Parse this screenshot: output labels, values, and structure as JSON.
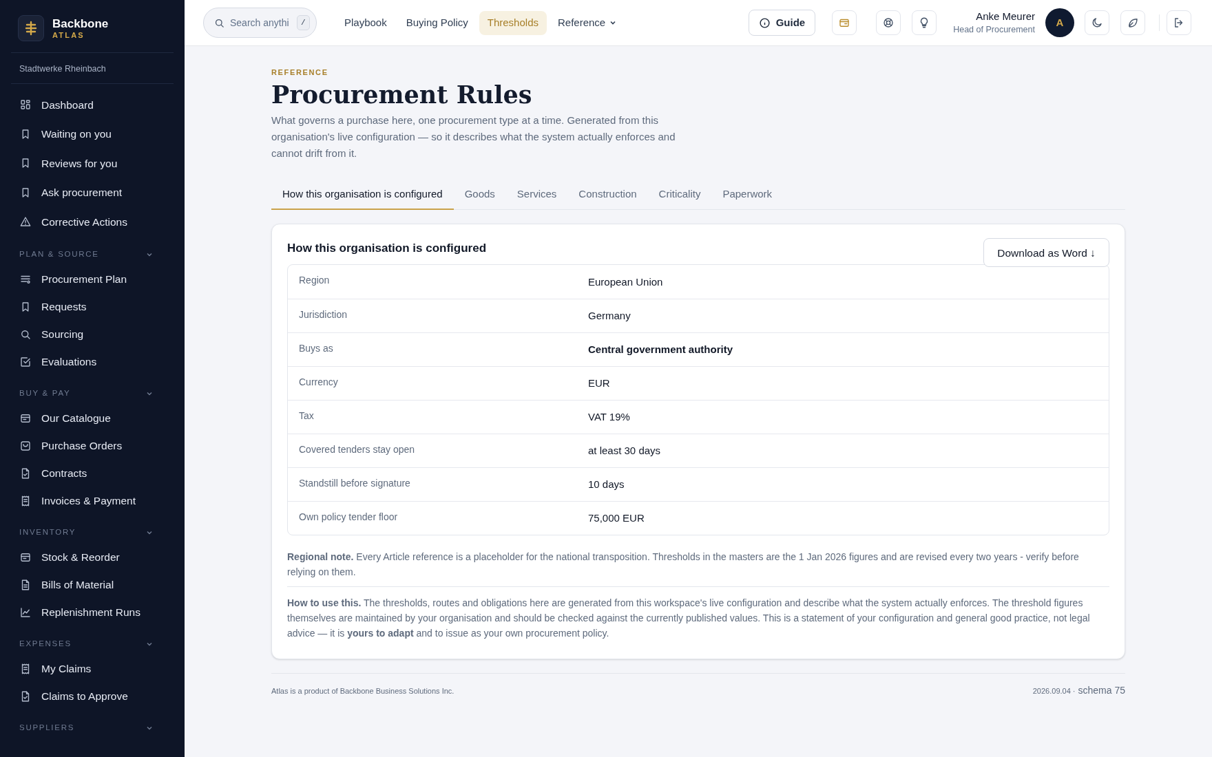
{
  "brand": {
    "name": "Backbone",
    "sub": "ATLAS"
  },
  "organisation": "Stadtwerke Rheinbach",
  "sidebar": {
    "items": [
      {
        "label": "Dashboard"
      },
      {
        "label": "Waiting on you"
      },
      {
        "label": "Reviews for you"
      },
      {
        "label": "Ask procurement"
      },
      {
        "label": "Corrective Actions"
      }
    ],
    "sections": [
      {
        "title": "PLAN & SOURCE",
        "expanded": true,
        "items": [
          {
            "label": "Procurement Plan"
          },
          {
            "label": "Requests"
          },
          {
            "label": "Sourcing"
          },
          {
            "label": "Evaluations"
          }
        ]
      },
      {
        "title": "BUY & PAY",
        "expanded": true,
        "items": [
          {
            "label": "Our Catalogue"
          },
          {
            "label": "Purchase Orders"
          },
          {
            "label": "Contracts"
          },
          {
            "label": "Invoices & Payment"
          }
        ]
      },
      {
        "title": "INVENTORY",
        "expanded": true,
        "items": [
          {
            "label": "Stock & Reorder"
          },
          {
            "label": "Bills of Material"
          },
          {
            "label": "Replenishment Runs"
          }
        ]
      },
      {
        "title": "EXPENSES",
        "expanded": true,
        "items": [
          {
            "label": "My Claims"
          },
          {
            "label": "Claims to Approve"
          }
        ]
      },
      {
        "title": "SUPPLIERS",
        "expanded": true
      }
    ]
  },
  "search": {
    "placeholder": "Search anythi",
    "shortcut": "/"
  },
  "nav": [
    {
      "label": "Playbook",
      "selected": false
    },
    {
      "label": "Buying Policy",
      "selected": false
    },
    {
      "label": "Thresholds",
      "selected": true
    },
    {
      "label": "Reference",
      "selected": false,
      "dropdown": true
    }
  ],
  "guide_button": "Guide",
  "user": {
    "name": "Anke Meurer",
    "role": "Head of Procurement",
    "initial": "A"
  },
  "page": {
    "eyebrow": "REFERENCE",
    "title": "Procurement Rules",
    "intro": "What governs a purchase here, one procurement type at a time. Generated from this organisation's live configuration — so it describes what the system actually enforces and cannot drift from it."
  },
  "tabs": [
    {
      "label": "How this organisation is configured",
      "selected": true
    },
    {
      "label": "Goods",
      "selected": false
    },
    {
      "label": "Services",
      "selected": false
    },
    {
      "label": "Construction",
      "selected": false
    },
    {
      "label": "Criticality",
      "selected": false
    },
    {
      "label": "Paperwork",
      "selected": false
    }
  ],
  "card": {
    "title": "How this organisation is configured",
    "download_button": "Download as Word ↓",
    "rows": [
      {
        "label": "Region",
        "value": "European Union",
        "bold": false
      },
      {
        "label": "Jurisdiction",
        "value": "Germany",
        "bold": false
      },
      {
        "label": "Buys as",
        "value": "Central government authority",
        "bold": true
      },
      {
        "label": "Currency",
        "value": "EUR",
        "bold": false
      },
      {
        "label": "Tax",
        "value": "VAT 19%",
        "bold": false
      },
      {
        "label": "Covered tenders stay open",
        "value": "at least 30 days",
        "bold": false
      },
      {
        "label": "Standstill before signature",
        "value": "10 days",
        "bold": false
      },
      {
        "label": "Own policy tender floor",
        "value": "75,000 EUR",
        "bold": false
      }
    ],
    "notes": [
      "**Regional note.** Every Article reference is a placeholder for the national transposition. Thresholds in the masters are the 1 Jan 2026 figures and are revised every two years - verify before relying on them.",
      "**How to use this.** The thresholds, routes and obligations here are generated from this workspace's live configuration and describe what the system actually enforces. The threshold figures themselves are maintained by your organisation and should be checked against the currently published values. This is a statement of your configuration and general good practice, not legal advice — it is **yours to adapt** and to issue as your own procurement policy."
    ]
  },
  "footer": {
    "credit": "Atlas is a product of Backbone Business Solutions Inc.",
    "date": "2026.09.04 ·",
    "schema": "schema 75"
  }
}
